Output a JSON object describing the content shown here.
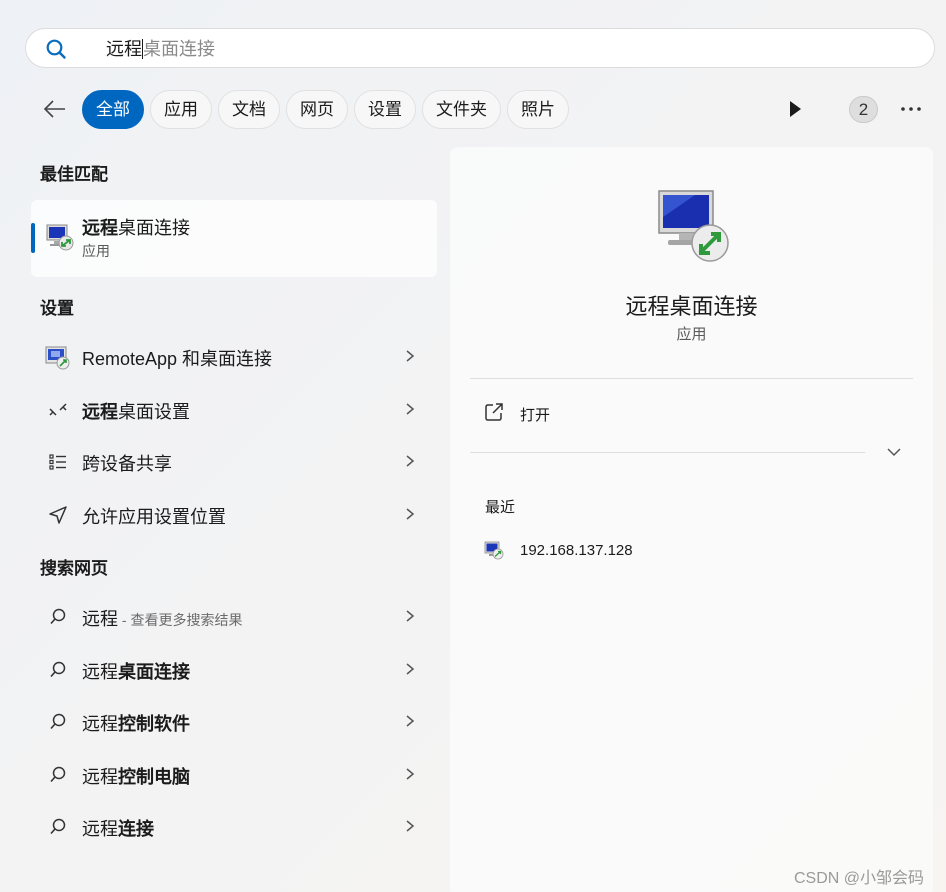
{
  "search": {
    "typed": "远程",
    "suggestion": "桌面连接"
  },
  "filters": {
    "tabs": [
      "全部",
      "应用",
      "文档",
      "网页",
      "设置",
      "文件夹",
      "照片"
    ],
    "count": "2"
  },
  "best_match": {
    "title": "最佳匹配",
    "name_bold": "远程",
    "name_rest": "桌面连接",
    "type": "应用"
  },
  "settings": {
    "title": "设置",
    "items": [
      {
        "bold": "",
        "rest": "RemoteApp 和桌面连接"
      },
      {
        "bold": "远程",
        "rest": "桌面设置"
      },
      {
        "bold": "",
        "rest": "跨设备共享"
      },
      {
        "bold": "",
        "rest": "允许应用设置位置"
      }
    ]
  },
  "web": {
    "title": "搜索网页",
    "items": [
      {
        "plain": "远程",
        "bold": "",
        "hint": " - 查看更多搜索结果"
      },
      {
        "plain": "远程",
        "bold": "桌面连接",
        "hint": ""
      },
      {
        "plain": "远程",
        "bold": "控制软件",
        "hint": ""
      },
      {
        "plain": "远程",
        "bold": "控制电脑",
        "hint": ""
      },
      {
        "plain": "远程",
        "bold": "连接",
        "hint": ""
      }
    ]
  },
  "detail": {
    "app_name": "远程桌面连接",
    "app_type": "应用",
    "open_label": "打开",
    "recent_title": "最近",
    "recent_items": [
      "192.168.137.128"
    ]
  },
  "watermark": "CSDN @小邹会码",
  "colors": {
    "accent": "#0067c0"
  }
}
